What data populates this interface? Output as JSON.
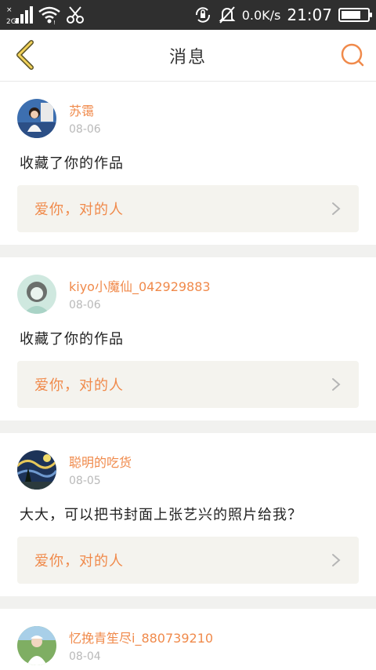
{
  "status_bar": {
    "network_type": "2G",
    "speed": "0.0K/s",
    "time": "21:07",
    "battery_level": 0.75,
    "icons": [
      "signal-icon",
      "wifi-icon",
      "scissors-icon",
      "rotation-lock-icon",
      "mute-bell-icon",
      "battery-icon"
    ]
  },
  "nav": {
    "title": "消息",
    "back_icon": "chevron-left-icon",
    "search_icon": "search-icon",
    "accent": "#f08a4b"
  },
  "messages": [
    {
      "username": "苏霭",
      "date": "08-06",
      "text": "收藏了你的作品",
      "link_text": "爱你，对的人"
    },
    {
      "username": "kiyo小魔仙_042929883",
      "date": "08-06",
      "text": "收藏了你的作品",
      "link_text": "爱你，对的人"
    },
    {
      "username": "聪明的吃货",
      "date": "08-05",
      "text": "大大，可以把书封面上张艺兴的照片给我？",
      "link_text": "爱你，对的人"
    },
    {
      "username": "忆挽青笙尽i_880739210",
      "date": "08-04"
    }
  ],
  "colors": {
    "accent": "#f08a4b",
    "status_bar_bg": "#2f2f2f",
    "link_bg": "#f4f3ee",
    "separator": "#f1f1ef"
  }
}
